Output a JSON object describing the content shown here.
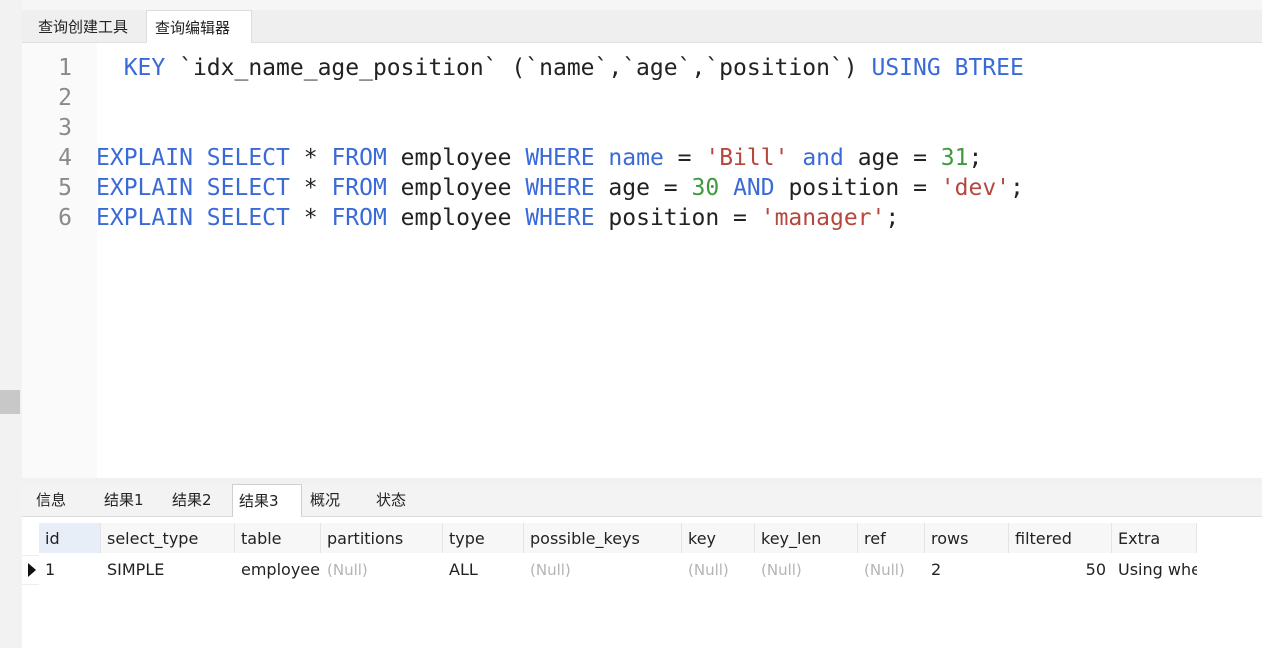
{
  "editor_tabs": [
    {
      "label": "查询创建工具",
      "active": false
    },
    {
      "label": "查询编辑器",
      "active": true
    }
  ],
  "code_lines": [
    {
      "n": "1",
      "tokens": [
        {
          "t": "  "
        },
        {
          "t": "KEY",
          "c": "kw"
        },
        {
          "t": " `idx_name_age_position` (`name`,`age`,`position`) "
        },
        {
          "t": "USING",
          "c": "kw"
        },
        {
          "t": " "
        },
        {
          "t": "BTREE",
          "c": "kw"
        }
      ]
    },
    {
      "n": "2",
      "tokens": []
    },
    {
      "n": "3",
      "tokens": []
    },
    {
      "n": "4",
      "tokens": [
        {
          "t": "EXPLAIN",
          "c": "kw"
        },
        {
          "t": " "
        },
        {
          "t": "SELECT",
          "c": "kw"
        },
        {
          "t": " * "
        },
        {
          "t": "FROM",
          "c": "kw"
        },
        {
          "t": " employee "
        },
        {
          "t": "WHERE",
          "c": "kw"
        },
        {
          "t": " "
        },
        {
          "t": "name",
          "c": "kw"
        },
        {
          "t": " = "
        },
        {
          "t": "'Bill'",
          "c": "str"
        },
        {
          "t": " "
        },
        {
          "t": "and",
          "c": "kw"
        },
        {
          "t": " age = "
        },
        {
          "t": "31",
          "c": "num"
        },
        {
          "t": ";"
        }
      ]
    },
    {
      "n": "5",
      "tokens": [
        {
          "t": "EXPLAIN",
          "c": "kw"
        },
        {
          "t": " "
        },
        {
          "t": "SELECT",
          "c": "kw"
        },
        {
          "t": " * "
        },
        {
          "t": "FROM",
          "c": "kw"
        },
        {
          "t": " employee "
        },
        {
          "t": "WHERE",
          "c": "kw"
        },
        {
          "t": " age = "
        },
        {
          "t": "30",
          "c": "num"
        },
        {
          "t": " "
        },
        {
          "t": "AND",
          "c": "kw"
        },
        {
          "t": " position = "
        },
        {
          "t": "'dev'",
          "c": "str"
        },
        {
          "t": ";"
        }
      ]
    },
    {
      "n": "6",
      "tokens": [
        {
          "t": "EXPLAIN",
          "c": "kw"
        },
        {
          "t": " "
        },
        {
          "t": "SELECT",
          "c": "kw"
        },
        {
          "t": " * "
        },
        {
          "t": "FROM",
          "c": "kw"
        },
        {
          "t": " employee "
        },
        {
          "t": "WHERE",
          "c": "kw"
        },
        {
          "t": " position = "
        },
        {
          "t": "'manager'",
          "c": "str"
        },
        {
          "t": ";"
        }
      ]
    }
  ],
  "result_tabs": [
    {
      "label": "信息",
      "active": false
    },
    {
      "label": "结果1",
      "active": false
    },
    {
      "label": "结果2",
      "active": false
    },
    {
      "label": "结果3",
      "active": true
    },
    {
      "label": "概况",
      "active": false
    },
    {
      "label": "状态",
      "active": false
    }
  ],
  "grid": {
    "columns": [
      "id",
      "select_type",
      "table",
      "partitions",
      "type",
      "possible_keys",
      "key",
      "key_len",
      "ref",
      "rows",
      "filtered",
      "Extra"
    ],
    "row": [
      "1",
      "SIMPLE",
      "employee",
      "(Null)",
      "ALL",
      "(Null)",
      "(Null)",
      "(Null)",
      "(Null)",
      "2",
      "50",
      "Using whe"
    ]
  },
  "colors": {
    "keyword": "#3a6ad8",
    "string": "#b5473d",
    "number": "#3d9a3d",
    "null_text": "#b4b4b4"
  }
}
